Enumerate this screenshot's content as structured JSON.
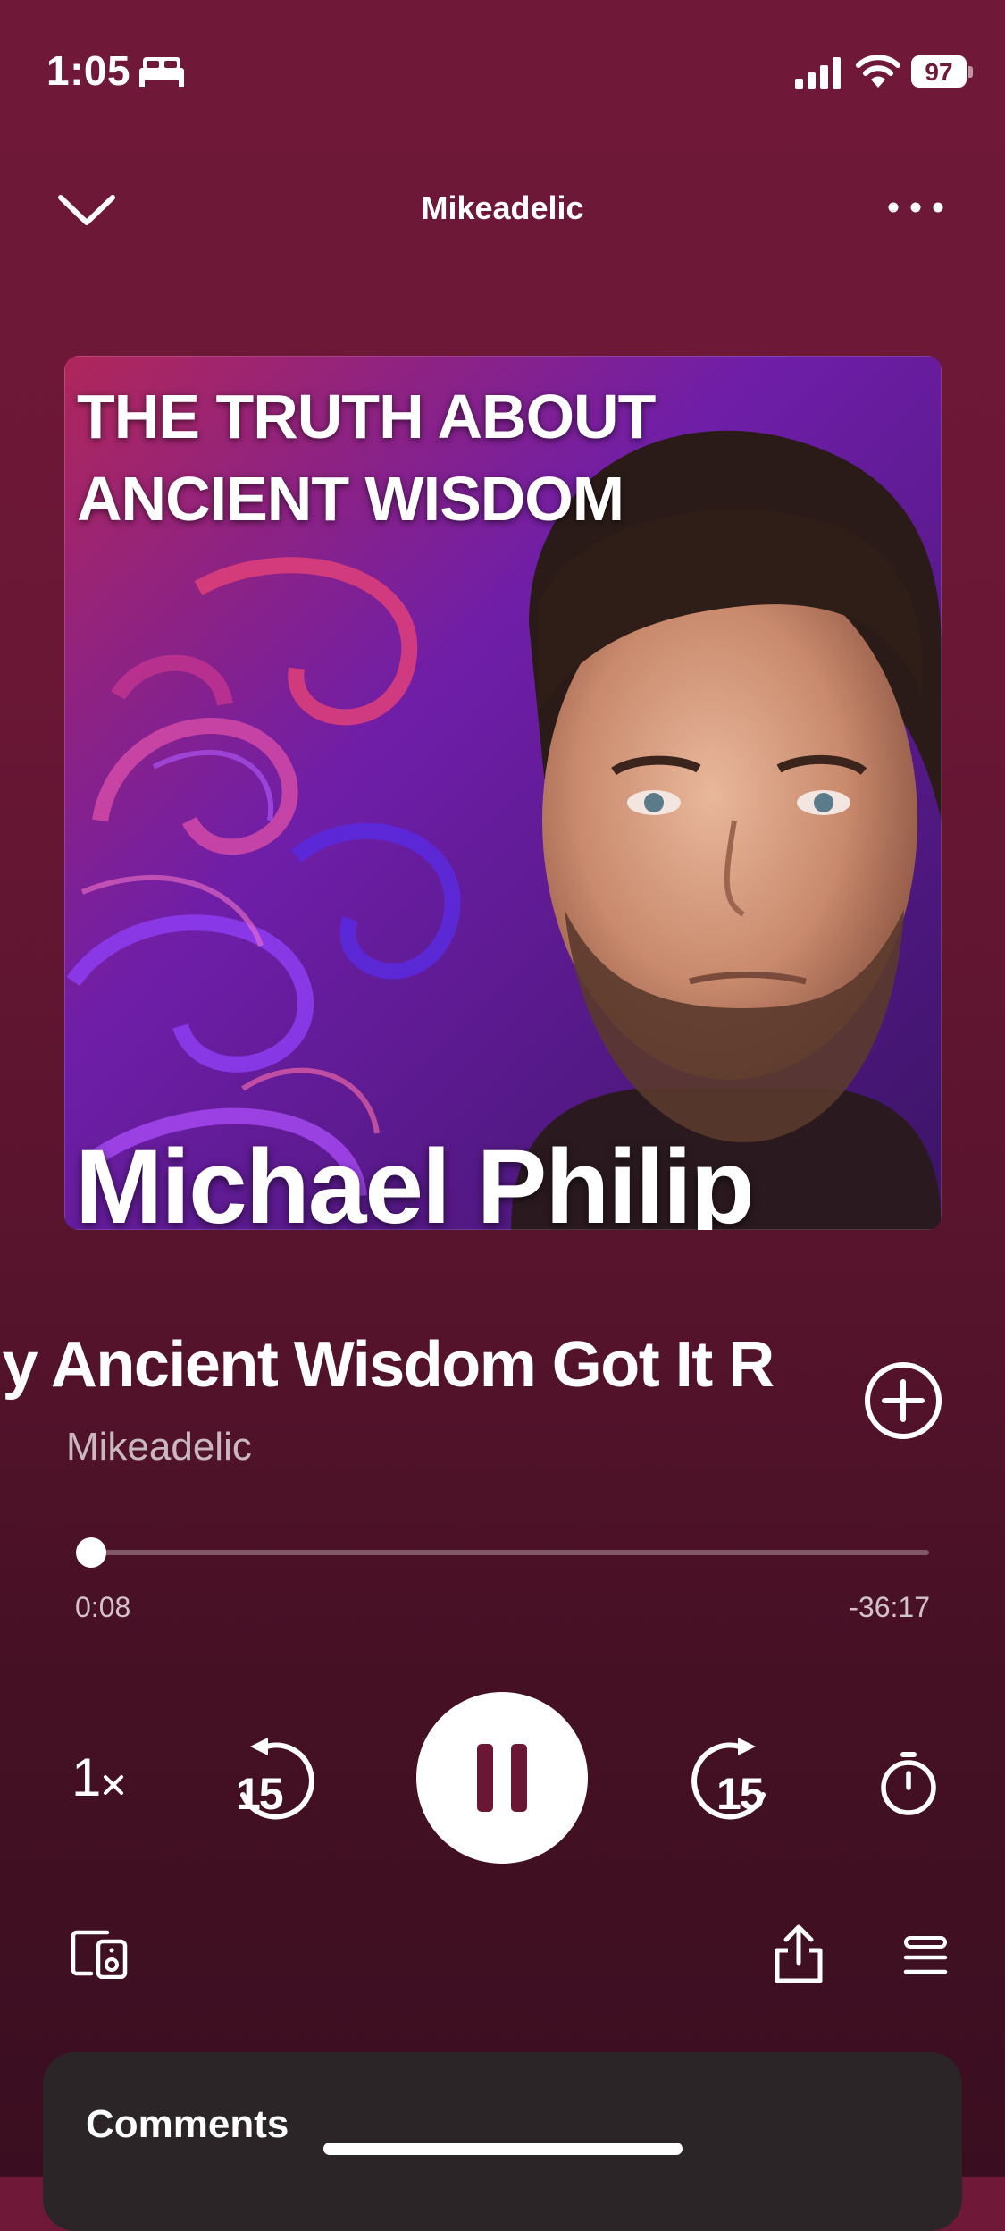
{
  "status_bar": {
    "time": "1:05",
    "battery": "97",
    "icons": [
      "sleep-focus-icon",
      "signal-icon",
      "wifi-icon",
      "battery-icon"
    ]
  },
  "header": {
    "title": "Mikeadelic",
    "icons": [
      "chevron-down-icon",
      "more-icon"
    ]
  },
  "artwork": {
    "title_line1": "THE TRUTH ABOUT",
    "title_line2": "ANCIENT WISDOM",
    "name": "Michael Philip"
  },
  "episode": {
    "title": "hy Ancient Wisdom Got It R",
    "show": "Mikeadelic"
  },
  "progress": {
    "elapsed": "0:08",
    "remaining": "-36:17",
    "fraction": 0.004
  },
  "controls": {
    "speed": "1",
    "skip_back": "15",
    "skip_forward": "15",
    "icons": [
      "speed-icon",
      "skip-back-15-icon",
      "pause-icon",
      "skip-forward-15-icon",
      "sleep-timer-icon",
      "devices-icon",
      "share-icon",
      "queue-icon"
    ]
  },
  "comments": {
    "label": "Comments"
  },
  "colors": {
    "background": "#701838",
    "card": "#2b2528",
    "foreground": "#ffffff"
  }
}
